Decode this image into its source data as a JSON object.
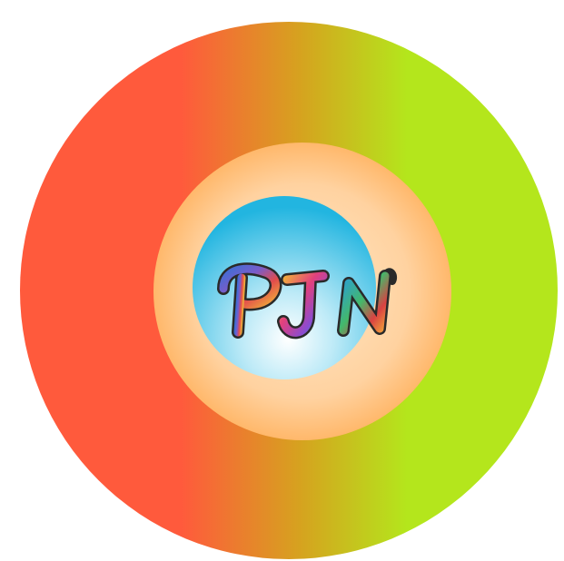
{
  "logo": {
    "text": "PJN",
    "colors": {
      "outer_ring_left": "#ff5a3c",
      "outer_ring_mid": "#d6a21f",
      "outer_ring_right": "#b4e61c",
      "middle_ring_outer": "#ffb86b",
      "middle_ring_inner": "#ffe8c7",
      "center_light": "#ffffff",
      "center_dark": "#22b5e0",
      "letter_p": "#7a5cc9",
      "letter_j": "#e2407d",
      "letter_n": "#2a9ed7"
    }
  }
}
